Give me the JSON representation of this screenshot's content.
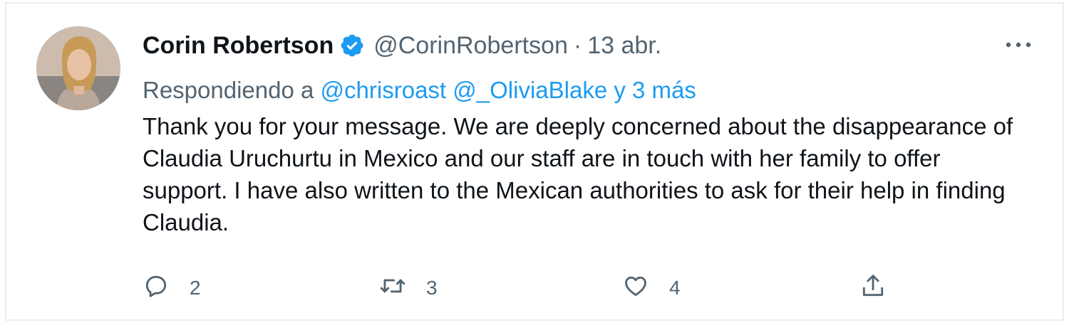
{
  "tweet": {
    "author_name": "Corin Robertson",
    "handle": "@CorinRobertson",
    "separator": "·",
    "date": "13 abr.",
    "replying_prefix": "Respondiendo a",
    "reply_mentions": [
      "@chrisroast",
      "@_OliviaBlake"
    ],
    "reply_more": "y 3 más",
    "text": "Thank you for your message. We are deeply concerned about the disappearance of Claudia Uruchurtu in Mexico and our staff are in touch with her family to offer support. I have also written to the Mexican authorities to ask for their help in finding Claudia.",
    "counts": {
      "replies": "2",
      "retweets": "3",
      "likes": "4"
    }
  },
  "icons": {
    "verified": "verified-badge-icon",
    "more": "more-options-icon",
    "reply": "reply-bubble-icon",
    "retweet": "retweet-arrows-icon",
    "like": "heart-icon",
    "share": "share-upload-icon"
  },
  "colors": {
    "accent": "#1d9bf0",
    "text": "#0f1419",
    "secondary": "#536471",
    "border": "#ebeef0"
  }
}
